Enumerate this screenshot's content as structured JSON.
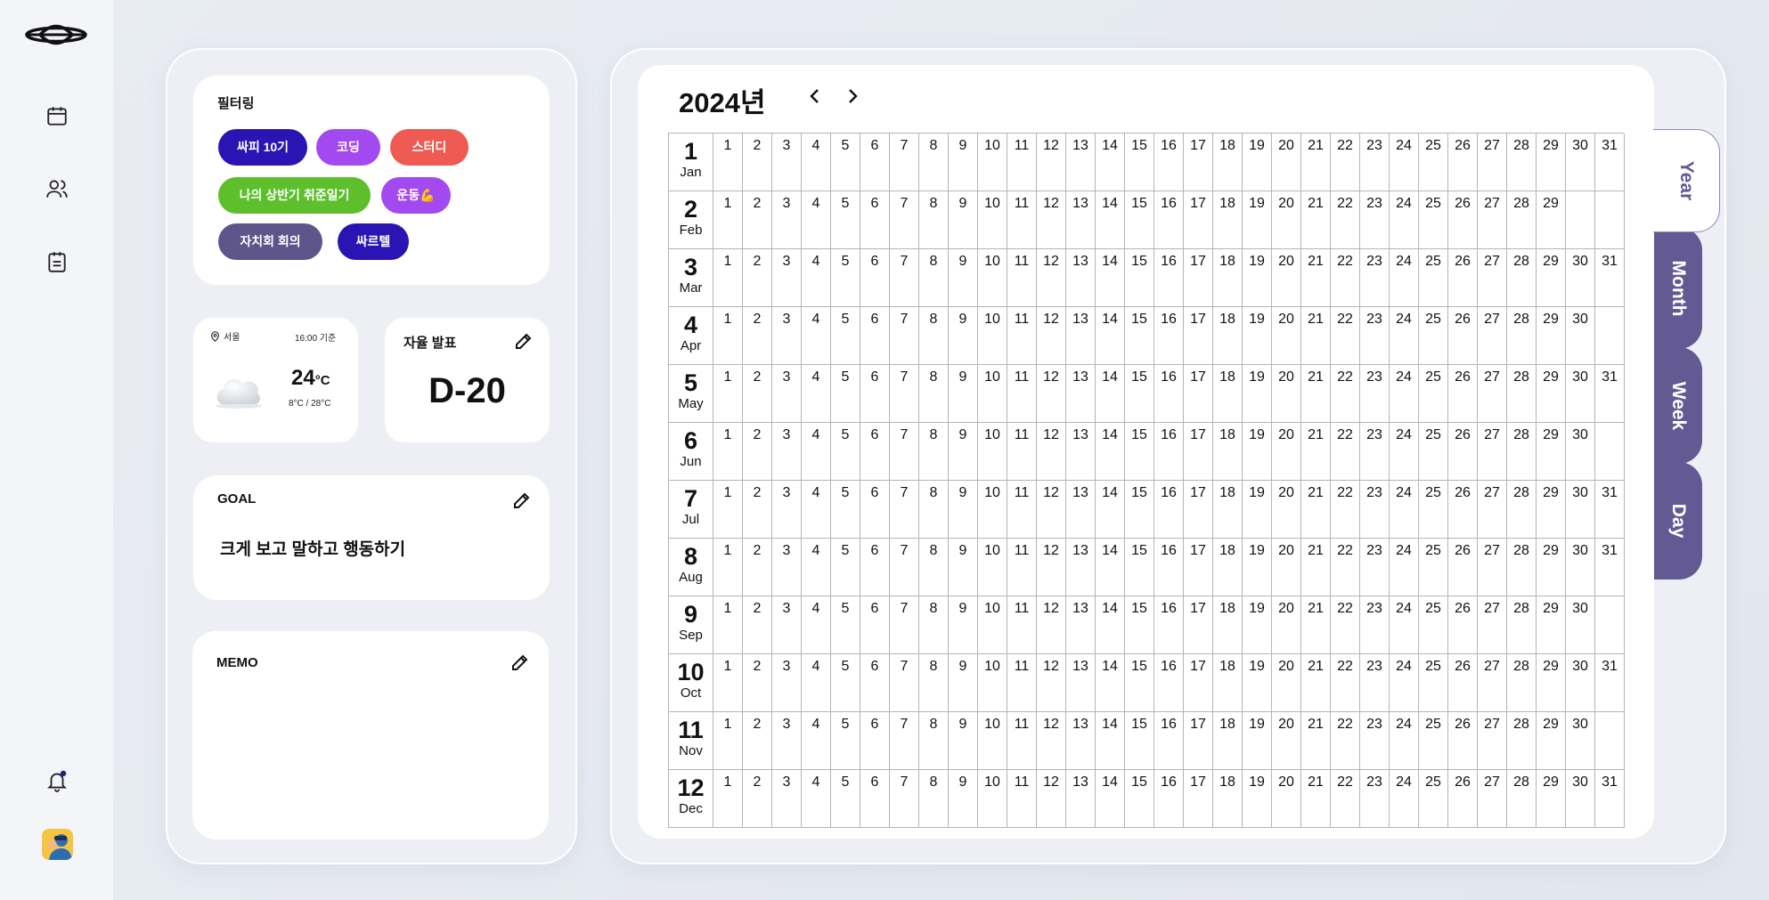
{
  "nav": {
    "items": [
      {
        "icon": "calendar-icon"
      },
      {
        "icon": "users-icon"
      },
      {
        "icon": "clipboard-icon"
      }
    ],
    "bell_icon": "bell-icon",
    "avatar_icon": "avatar"
  },
  "filter": {
    "title": "필터링",
    "chips": [
      {
        "label": "싸피 10기",
        "color": "#2a14b4"
      },
      {
        "label": "코딩",
        "color": "#a24af0"
      },
      {
        "label": "스터디",
        "color": "#ef5b52"
      },
      {
        "label": "나의 상반기 취준일기",
        "color": "#5dbf2c"
      },
      {
        "label": "운동💪",
        "color": "#a24af0"
      },
      {
        "label": "자치회 회의",
        "color": "#5e568a"
      },
      {
        "label": "싸르텔",
        "color": "#2a14b4"
      }
    ]
  },
  "weather": {
    "location": "서울",
    "time": "16:00 기준",
    "temp": "24",
    "unit": "°C",
    "range": "8°C / 28°C"
  },
  "dday": {
    "title": "자율 발표",
    "value": "D-20"
  },
  "goal": {
    "title": "GOAL",
    "text": "크게 보고 말하고 행동하기"
  },
  "memo": {
    "title": "MEMO",
    "text": ""
  },
  "calendar": {
    "year_label": "2024년",
    "months": [
      {
        "num": "1",
        "name": "Jan",
        "days": 31
      },
      {
        "num": "2",
        "name": "Feb",
        "days": 29
      },
      {
        "num": "3",
        "name": "Mar",
        "days": 31
      },
      {
        "num": "4",
        "name": "Apr",
        "days": 30
      },
      {
        "num": "5",
        "name": "May",
        "days": 31
      },
      {
        "num": "6",
        "name": "Jun",
        "days": 30
      },
      {
        "num": "7",
        "name": "Jul",
        "days": 31
      },
      {
        "num": "8",
        "name": "Aug",
        "days": 31
      },
      {
        "num": "9",
        "name": "Sep",
        "days": 30
      },
      {
        "num": "10",
        "name": "Oct",
        "days": 31
      },
      {
        "num": "11",
        "name": "Nov",
        "days": 30
      },
      {
        "num": "12",
        "name": "Dec",
        "days": 31
      }
    ]
  },
  "views": {
    "tabs": [
      "Year",
      "Month",
      "Week",
      "Day"
    ],
    "active": "Year"
  },
  "colors": {
    "accent": "#635a93",
    "background": "#e9ecf3"
  }
}
